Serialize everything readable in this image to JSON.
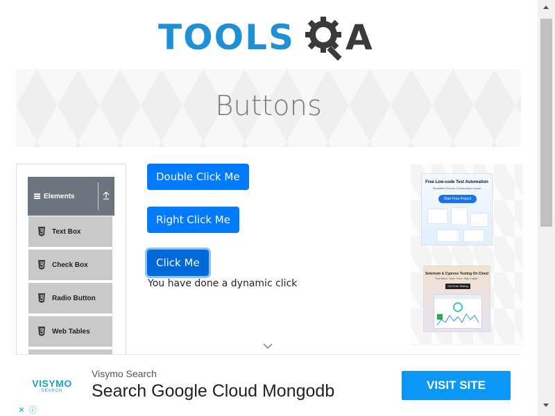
{
  "header": {
    "logo_text": "TOOLS",
    "logo_suffix": "A"
  },
  "banner": {
    "title": "Buttons"
  },
  "sidebar": {
    "group": {
      "label": "Elements",
      "icon": "menu-icon",
      "toggle_icon": "upload-arrow-icon"
    },
    "items": [
      {
        "label": "Text Box",
        "icon": "html5-icon"
      },
      {
        "label": "Check Box",
        "icon": "html5-icon"
      },
      {
        "label": "Radio Button",
        "icon": "html5-icon"
      },
      {
        "label": "Web Tables",
        "icon": "html5-icon"
      }
    ]
  },
  "main": {
    "double_click_label": "Double Click Me",
    "right_click_label": "Right Click Me",
    "click_label": "Click Me",
    "dynamic_message": "You have done a dynamic click"
  },
  "ads": {
    "side1": {
      "title": "Free Low-code Test Automation",
      "subtitle": "SimpliMod Secure Community's choice",
      "cta": "Start Free Project"
    },
    "side2": {
      "title": "Selenium & Cypress Testing On Cloud",
      "subtitle": "Test More. Save Time. Ship Faster.",
      "cta": "Get Free Testing"
    },
    "bottom": {
      "logo": "VISYMO",
      "logo_sub": "SEARCH",
      "brand": "Visymo Search",
      "headline": "Search Google Cloud Mongodb",
      "cta": "VISIT SITE"
    }
  },
  "colors": {
    "primary": "#007bff",
    "logo_blue": "#1f8fd6",
    "logo_dark": "#3a3a3a",
    "sidebar_header": "#6c757d",
    "sidebar_item": "#c9c9c9",
    "ad_cta": "#0a97f5"
  }
}
